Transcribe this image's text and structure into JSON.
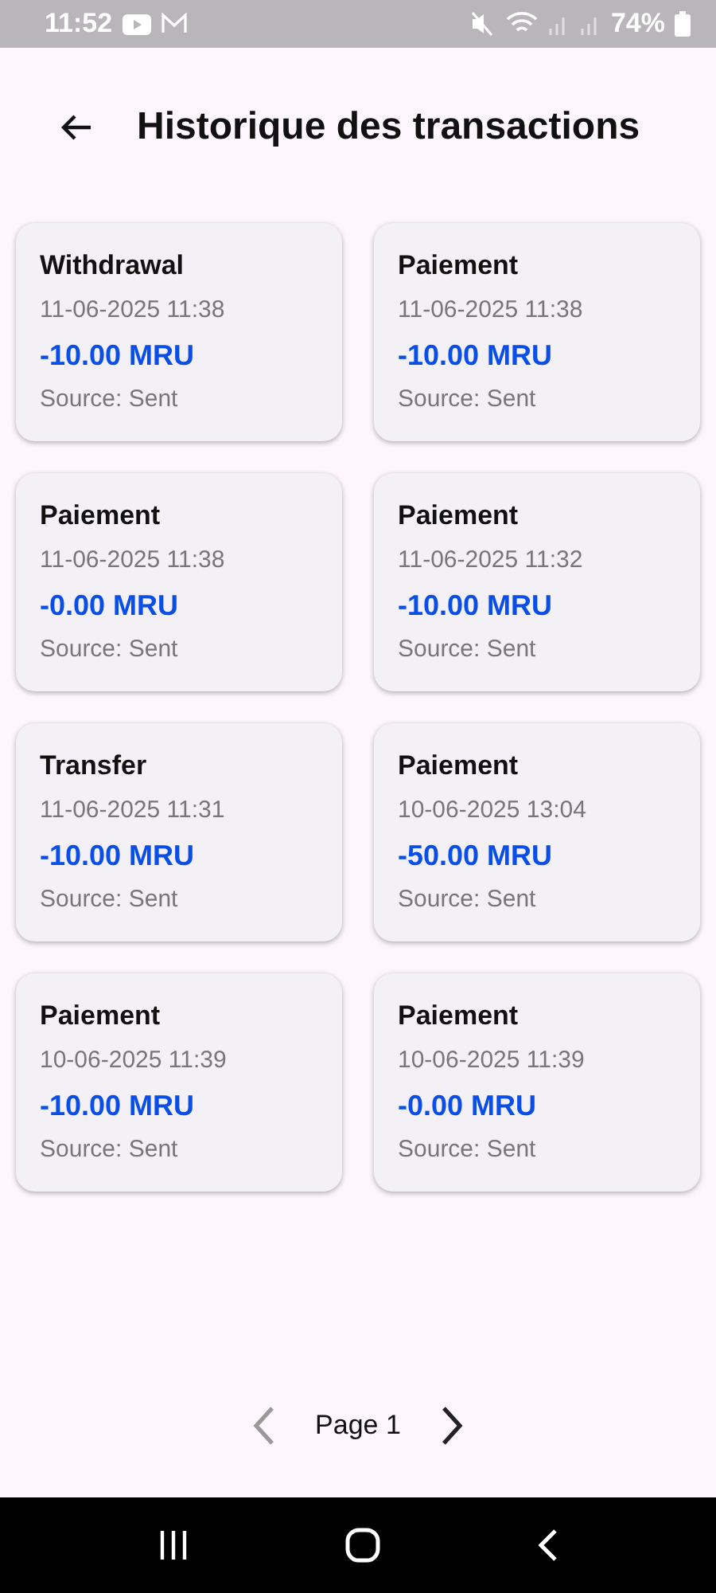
{
  "status_bar": {
    "time": "11:52",
    "battery": "74%"
  },
  "header": {
    "title": "Historique des transactions"
  },
  "transactions": [
    {
      "type": "Withdrawal",
      "date": "11-06-2025 11:38",
      "amount": "-10.00 MRU",
      "source": "Source: Sent"
    },
    {
      "type": "Paiement",
      "date": "11-06-2025 11:38",
      "amount": "-10.00 MRU",
      "source": "Source: Sent"
    },
    {
      "type": "Paiement",
      "date": "11-06-2025 11:38",
      "amount": "-0.00 MRU",
      "source": "Source: Sent"
    },
    {
      "type": "Paiement",
      "date": "11-06-2025 11:32",
      "amount": "-10.00 MRU",
      "source": "Source: Sent"
    },
    {
      "type": "Transfer",
      "date": "11-06-2025 11:31",
      "amount": "-10.00 MRU",
      "source": "Source: Sent"
    },
    {
      "type": "Paiement",
      "date": "10-06-2025 13:04",
      "amount": "-50.00 MRU",
      "source": "Source: Sent"
    },
    {
      "type": "Paiement",
      "date": "10-06-2025 11:39",
      "amount": "-10.00 MRU",
      "source": "Source: Sent"
    },
    {
      "type": "Paiement",
      "date": "10-06-2025 11:39",
      "amount": "-0.00 MRU",
      "source": "Source: Sent"
    }
  ],
  "pagination": {
    "label": "Page 1",
    "previous_disabled": true,
    "next_disabled": false
  }
}
